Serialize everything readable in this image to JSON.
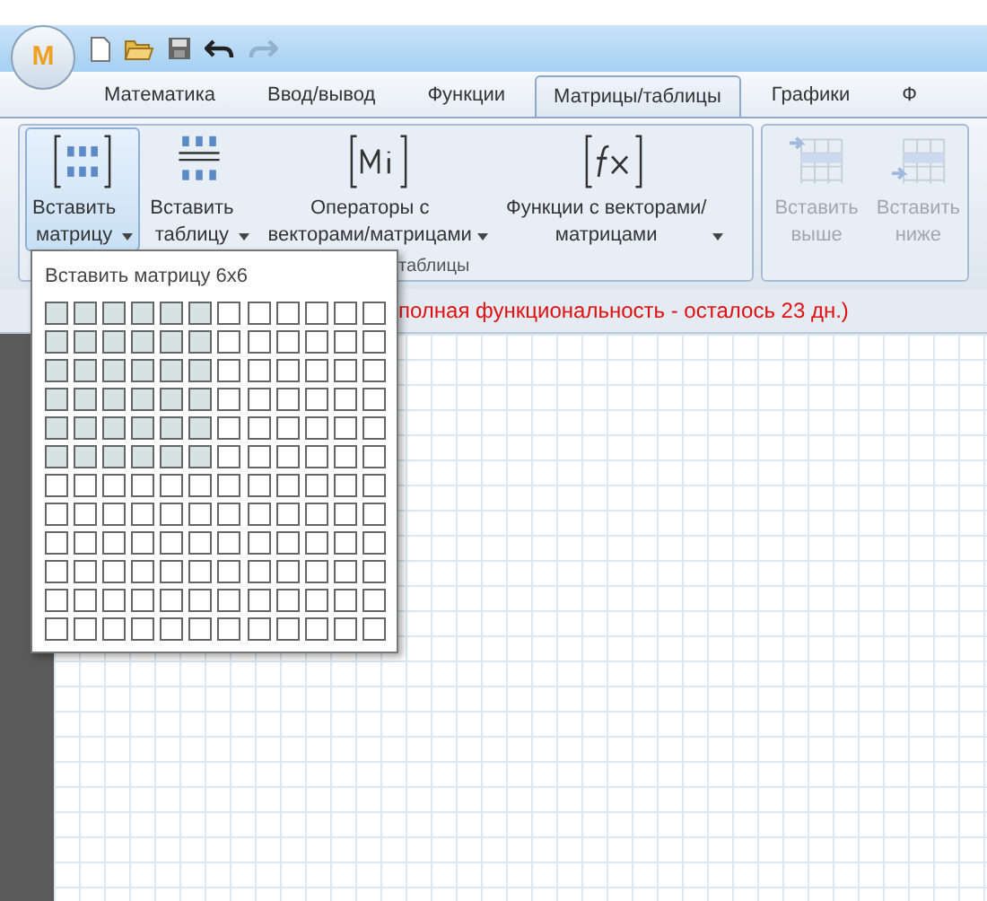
{
  "quick_access": {
    "logo": "M"
  },
  "tabs": [
    {
      "label": "Математика",
      "selected": false
    },
    {
      "label": "Ввод/вывод",
      "selected": false
    },
    {
      "label": "Функции",
      "selected": false
    },
    {
      "label": "Матрицы/таблицы",
      "selected": true
    },
    {
      "label": "Графики",
      "selected": false
    },
    {
      "label": "Ф",
      "selected": false
    }
  ],
  "ribbon": {
    "groups": [
      {
        "label": "таблицы",
        "buttons": [
          {
            "kind": "matrix",
            "label": "Вставить\nматрицу",
            "dropdown": true,
            "selected": true,
            "disabled": false
          },
          {
            "kind": "table",
            "label": "Вставить\nтаблицу",
            "dropdown": true,
            "selected": false,
            "disabled": false
          },
          {
            "kind": "mi",
            "label": "Операторы с\nвекторами/матрицами",
            "dropdown": true,
            "selected": false,
            "disabled": false
          },
          {
            "kind": "fx",
            "label": "Функции с векторами/\nматрицами",
            "dropdown": true,
            "selected": false,
            "disabled": false
          }
        ]
      },
      {
        "buttons": [
          {
            "kind": "above",
            "label": "Вставить\nвыше",
            "dropdown": false,
            "selected": false,
            "disabled": true
          },
          {
            "kind": "below",
            "label": "Вставить\nниже",
            "dropdown": false,
            "selected": false,
            "disabled": true
          }
        ]
      }
    ]
  },
  "notice": "полная функциональность - осталось 23 дн.)",
  "matrix_popup": {
    "title": "Вставить матрицу 6x6",
    "rows": [
      {
        "selected": true
      },
      {
        "selected": true
      },
      {
        "selected": true
      },
      {
        "selected": true
      },
      {
        "selected": true
      },
      {
        "selected": true
      },
      {
        "selected": false
      },
      {
        "selected": false
      },
      {
        "selected": false
      },
      {
        "selected": false
      },
      {
        "selected": false
      },
      {
        "selected": false
      }
    ],
    "columns": [
      {
        "selected": true
      },
      {
        "selected": true
      },
      {
        "selected": true
      },
      {
        "selected": true
      },
      {
        "selected": true
      },
      {
        "selected": true
      },
      {
        "selected": false
      },
      {
        "selected": false
      },
      {
        "selected": false
      },
      {
        "selected": false
      },
      {
        "selected": false
      },
      {
        "selected": false
      }
    ]
  }
}
